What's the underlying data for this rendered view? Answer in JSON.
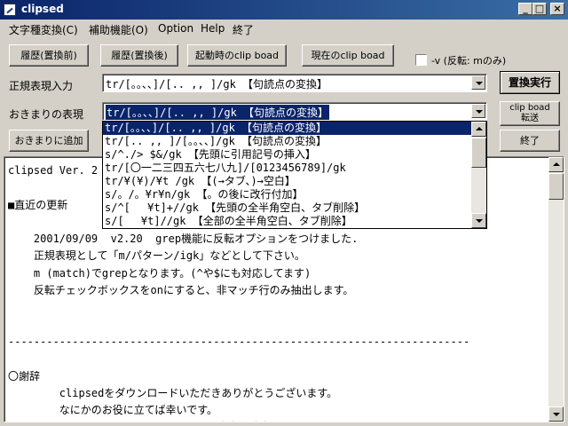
{
  "window": {
    "title": "clipsed"
  },
  "menu": [
    "文字種変換(C)",
    "補助機能(O)",
    "Option",
    "Help",
    "終了"
  ],
  "buttons": {
    "history_before": "履歴(置換前)",
    "history_after": "履歴(置換後)",
    "startup_clip": "起動時のclip boad",
    "current_clip": "現在のclip boad",
    "replace_exec": "置換実行",
    "clip_transfer_1": "clip boad",
    "clip_transfer_2": "転送",
    "add_preset": "おきまりに追加",
    "exit": "終了"
  },
  "checkbox": {
    "label": "-v (反転: mのみ)",
    "checked": false
  },
  "labels": {
    "regex_input": "正規表現入力",
    "preset": "おきまりの表現"
  },
  "regex_input": {
    "value": "tr/[。。、、]/[.. ,, ]/gk 【句読点の変換】"
  },
  "preset_combo": {
    "value": "tr/[。。、、]/[.. ,, ]/gk 【句読点の変換】"
  },
  "dropdown": {
    "items": [
      "tr/[。。、、]/[.. ,, ]/gk 【句読点の変換】",
      "tr/[.. ,, ]/[。。、、]/gk 【句読点の変換】",
      "s/^./> $&/gk 【先頭に引用記号の挿入】",
      "tr/[〇一二三四五六七八九]/[0123456789]/gk",
      "tr/¥(¥)/¥t /gk 【(→タブ、)→空白】",
      "s/。/。¥r¥n/gk 【。の後に改行付加】",
      "s/^[　 ¥t]+//gk 【先頭の全半角空白、タブ削除】",
      "s/[　 ¥t]//gk 【全部の全半角空白、タブ削除】"
    ],
    "selected_index": 0
  },
  "text_lines": [
    "clipsed Ver. 2",
    "",
    "■直近の更新",
    "",
    "    2001/09/09  v2.20  grep機能に反転オプションをつけました.",
    "    正規表現として「m/パターン/igk」などとして下さい。",
    "    m (match)でgrepとなります。(^や$にも対応してます)",
    "    反転チェックボックスをonにすると、非マッチ行のみ抽出します。",
    "",
    "",
    "------------------------------------------------------------------------",
    "",
    "〇謝辞",
    "        clipsedをダウンロードいただきありがとうございます。",
    "        なにかのお役に立てば幸いです。",
    "        ソースもつけておりますので、ご自由に改良なさってください。"
  ]
}
